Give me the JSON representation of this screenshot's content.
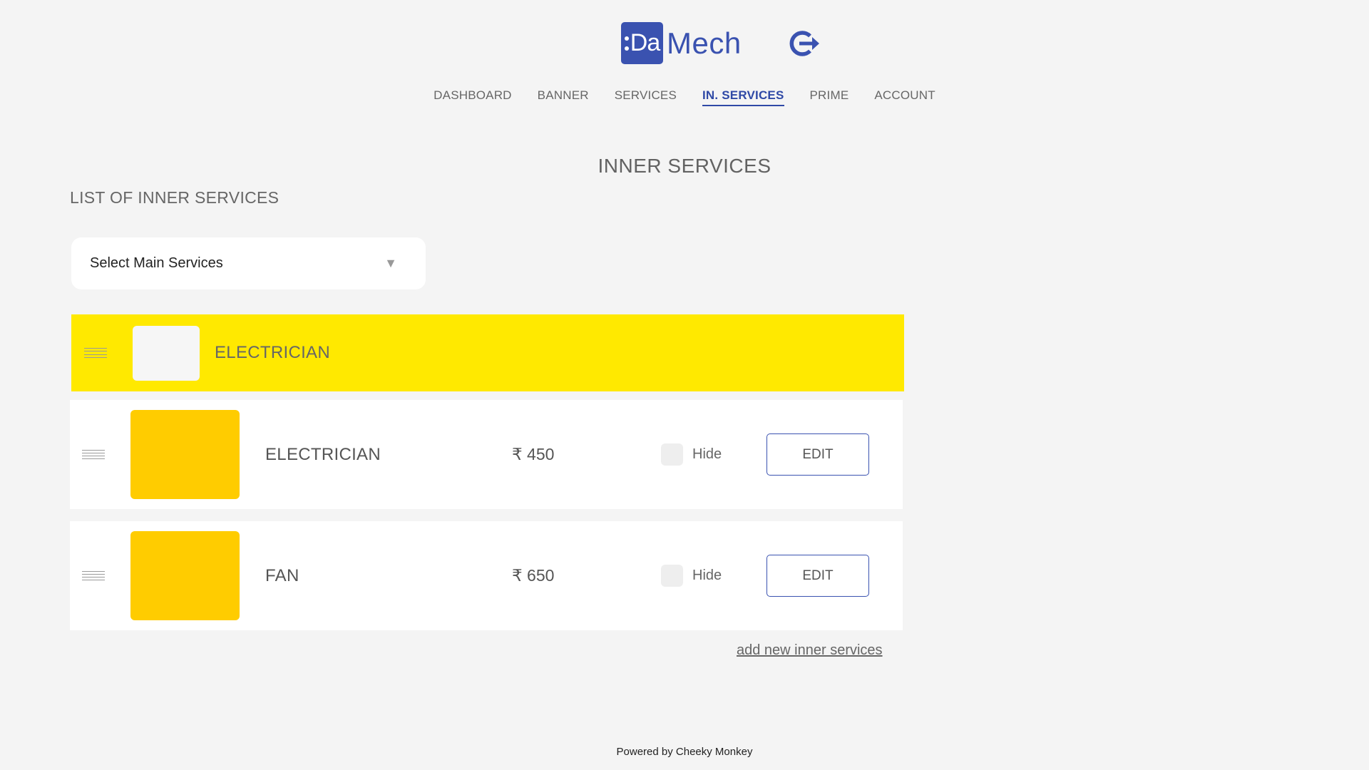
{
  "brand": {
    "badge_text": "Da",
    "word": "Mech",
    "brand_color": "#3a52b0"
  },
  "header": {
    "logout_icon": "logout-icon"
  },
  "nav": {
    "items": [
      {
        "label": "DASHBOARD",
        "active": false
      },
      {
        "label": "BANNER",
        "active": false
      },
      {
        "label": "SERVICES",
        "active": false
      },
      {
        "label": "IN. SERVICES",
        "active": true
      },
      {
        "label": "PRIME",
        "active": false
      },
      {
        "label": "ACCOUNT",
        "active": false
      }
    ],
    "active_color": "#2f49a6"
  },
  "page": {
    "title": "INNER SERVICES",
    "list_title": "LIST OF INNER SERVICES"
  },
  "select": {
    "value": "Select Main Services",
    "arrow_icon": "triangle-down-icon"
  },
  "category": {
    "name": "ELECTRICIAN",
    "highlight_color": "#ffe900"
  },
  "services": [
    {
      "name": "ELECTRICIAN",
      "price": "₹ 450",
      "hide_label": "Hide",
      "hidden": false,
      "edit_label": "EDIT",
      "thumb_color": "#ffcc00"
    },
    {
      "name": "FAN",
      "price": "₹ 650",
      "hide_label": "Hide",
      "hidden": false,
      "edit_label": "EDIT",
      "thumb_color": "#ffcc00"
    }
  ],
  "actions": {
    "add_link": "add new inner services"
  },
  "footer": {
    "text": "Powered by Cheeky Monkey"
  }
}
